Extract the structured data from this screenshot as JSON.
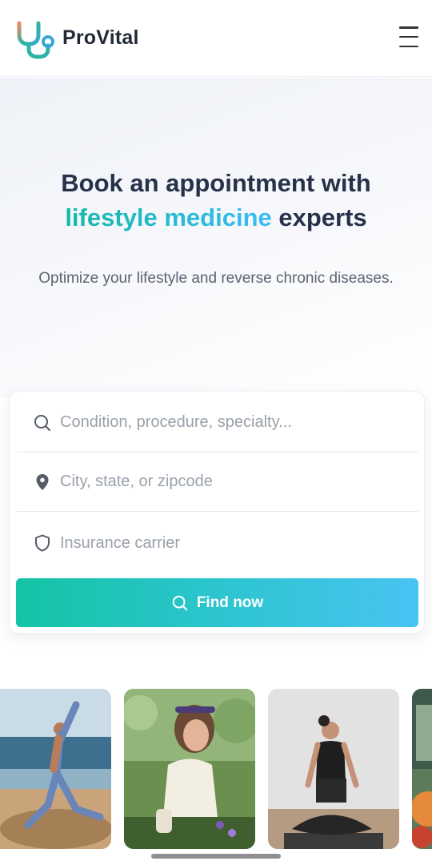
{
  "header": {
    "brand": "ProVital",
    "logo_icon": "stethoscope-icon",
    "menu_icon": "hamburger-menu-icon"
  },
  "hero": {
    "title_part1": "Book an appointment with ",
    "title_accent": "lifestyle medicine",
    "title_part2": " experts",
    "subtitle": "Optimize your lifestyle and reverse chronic diseases."
  },
  "search": {
    "condition_placeholder": "Condition, procedure, specialty...",
    "condition_icon": "search-icon",
    "location_placeholder": "City, state, or zipcode",
    "location_icon": "map-pin-icon",
    "insurance_placeholder": "Insurance carrier",
    "insurance_icon": "shield-icon",
    "button_label": "Find now",
    "button_icon": "search-icon"
  },
  "gallery": {
    "photos": [
      "yoga-beach-photo",
      "gardening-photo",
      "meditation-photo",
      "food-photo"
    ]
  },
  "colors": {
    "accent_start": "#14b8a6",
    "accent_end": "#38bdf8",
    "title": "#27324a"
  }
}
